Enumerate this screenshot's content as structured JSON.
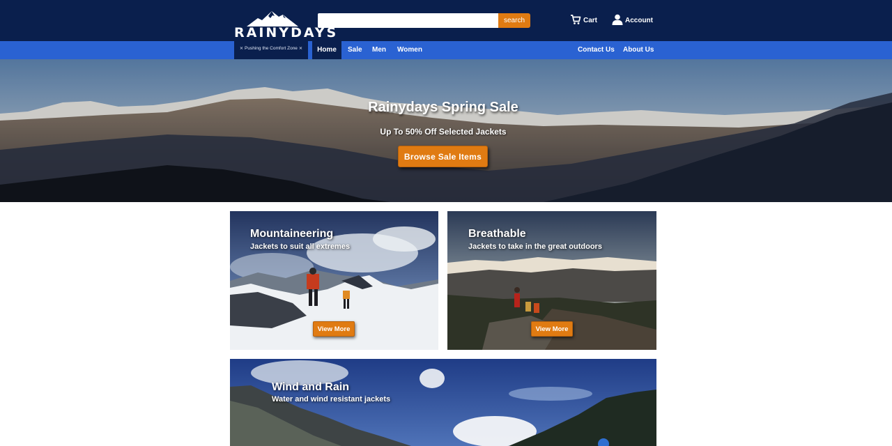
{
  "header": {
    "brand": "RAINYDAYS",
    "tagline": "⨯ Pushing the Comfort Zone ⨯",
    "search": {
      "value": "",
      "placeholder": "",
      "button_label": "search"
    },
    "cart_label": "Cart",
    "account_label": "Account"
  },
  "nav": {
    "items": [
      {
        "label": "Home",
        "active": true
      },
      {
        "label": "Sale"
      },
      {
        "label": "Men"
      },
      {
        "label": "Women"
      }
    ],
    "right_items": [
      {
        "label": "Contact Us"
      },
      {
        "label": "About Us"
      }
    ]
  },
  "hero": {
    "title": "Rainydays Spring Sale",
    "subtitle": "Up To 50% Off Selected Jackets",
    "button_label": "Browse Sale Items"
  },
  "categories": [
    {
      "title": "Mountaineering",
      "subtitle": "Jackets to suit all extremes",
      "button_label": "View More"
    },
    {
      "title": "Breathable",
      "subtitle": "Jackets to take in the great outdoors",
      "button_label": "View More"
    },
    {
      "title": "Wind and Rain",
      "subtitle": "Water and wind resistant jackets"
    }
  ],
  "colors": {
    "header_bg": "#0a1f4d",
    "nav_bg": "#2a62d2",
    "accent": "#e07b12"
  },
  "icons": [
    "mountain-logo-icon",
    "cart-icon",
    "user-icon"
  ]
}
